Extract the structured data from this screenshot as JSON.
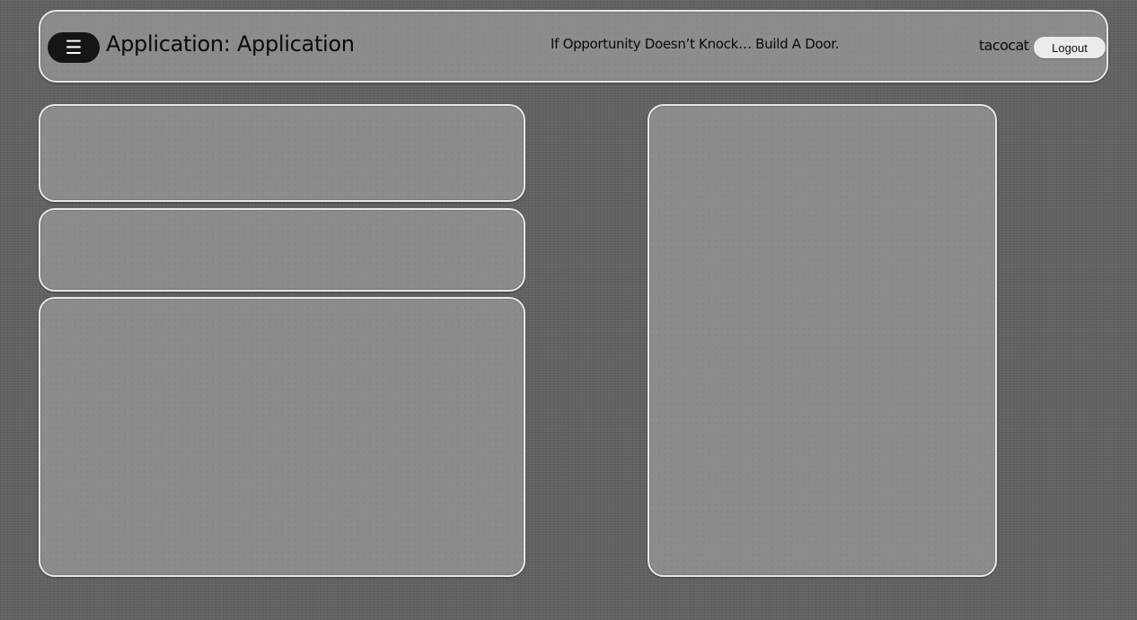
{
  "header": {
    "menu_icon": "☰",
    "app_title": "Application: Application",
    "quote": "If Opportunity Doesn’t Knock… Build A Door.",
    "username": "tacocat",
    "logout_label": "Logout"
  }
}
